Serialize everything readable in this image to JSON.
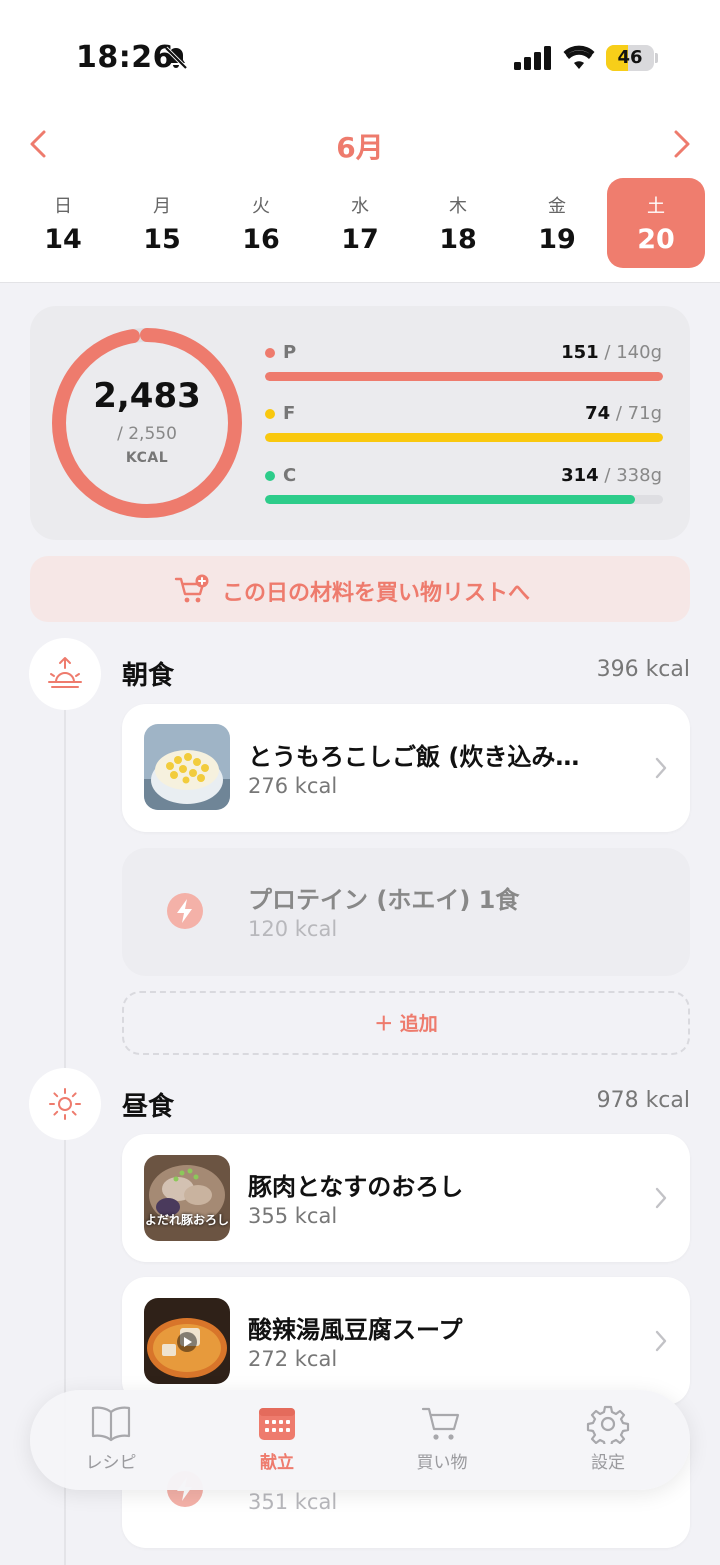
{
  "status": {
    "time": "18:26",
    "battery": "46",
    "battery_level": 0.46
  },
  "calendar": {
    "month": "6月",
    "days": [
      {
        "dow": "日",
        "num": "14"
      },
      {
        "dow": "月",
        "num": "15"
      },
      {
        "dow": "火",
        "num": "16"
      },
      {
        "dow": "水",
        "num": "17"
      },
      {
        "dow": "木",
        "num": "18"
      },
      {
        "dow": "金",
        "num": "19"
      },
      {
        "dow": "土",
        "num": "20",
        "selected": true
      }
    ]
  },
  "summary": {
    "kcal": "2,483",
    "kcal_target": "/ 2,550",
    "kcal_unit": "KCAL",
    "kcal_progress": 0.974,
    "macros": [
      {
        "letter": "P",
        "value": "151",
        "target": "/ 140g",
        "progress": 1.0,
        "color": "#ee7b6d"
      },
      {
        "letter": "F",
        "value": "74",
        "target": "/ 71g",
        "progress": 1.0,
        "color": "#f9c80e"
      },
      {
        "letter": "C",
        "value": "314",
        "target": "/ 338g",
        "progress": 0.929,
        "color": "#2dcc8a"
      }
    ]
  },
  "shopping_button": {
    "label": "この日の材料を買い物リストへ"
  },
  "meals": {
    "breakfast": {
      "title": "朝食",
      "kcal": "396 kcal",
      "items": [
        {
          "name": "とうもろこしご飯 (炊き込み…",
          "kcal": "276 kcal"
        },
        {
          "name": "プロテイン (ホエイ) 1食",
          "kcal": "120 kcal"
        }
      ],
      "add_label": "＋ 追加"
    },
    "lunch": {
      "title": "昼食",
      "kcal": "978 kcal",
      "items": [
        {
          "name": "豚肉となすのおろし",
          "kcal": "355 kcal",
          "thumb_caption": "よだれ豚おろし"
        },
        {
          "name": "酸辣湯風豆腐スープ",
          "kcal": "272 kcal"
        },
        {
          "name": "",
          "kcal": "351 kcal"
        }
      ]
    }
  },
  "nav": {
    "items": [
      {
        "label": "レシピ",
        "icon": "book-icon"
      },
      {
        "label": "献立",
        "icon": "calendar-icon",
        "active": true
      },
      {
        "label": "買い物",
        "icon": "cart-icon"
      },
      {
        "label": "設定",
        "icon": "gear-icon"
      }
    ]
  },
  "colors": {
    "accent": "#ee7b6d",
    "protein": "#ee7b6d",
    "fat": "#f9c80e",
    "carbs": "#2dcc8a"
  }
}
